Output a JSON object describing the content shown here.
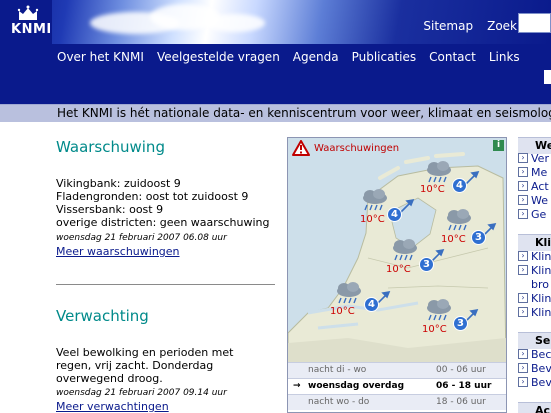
{
  "header": {
    "logo_text": "KNMI",
    "utility_nav": [
      "Sitemap",
      "Zoek"
    ],
    "main_nav": [
      "Over het KNMI",
      "Veelgestelde vragen",
      "Agenda",
      "Publicaties",
      "Contact",
      "Links"
    ],
    "tagline": "Het KNMI is hét nationale data- en kenniscentrum voor weer, klimaat en seismologie"
  },
  "warning": {
    "title": "Waarschuwing",
    "lines": [
      "Vikingbank: zuidoost 9",
      "Fladengronden: oost tot zuidoost 9",
      "Vissersbank: oost 9",
      "overige districten: geen waarschuwing"
    ],
    "timestamp": "woensdag 21 februari 2007 06.08 uur",
    "more_link": "Meer waarschuwingen"
  },
  "forecast": {
    "title": "Verwachting",
    "lines": [
      "Veel bewolking en perioden met",
      "regen, vrij zacht. Donderdag",
      "overwegend droog."
    ],
    "timestamp": "woensdag 21 februari 2007 09.14 uur",
    "more_link": "Meer verwachtingen"
  },
  "map": {
    "header": "Waarschuwingen",
    "info_label": "i",
    "stations": [
      {
        "temp": "10°C",
        "wind": "4"
      },
      {
        "temp": "10°C",
        "wind": "4"
      },
      {
        "temp": "10°C",
        "wind": "3"
      },
      {
        "temp": "10°C",
        "wind": "3"
      },
      {
        "temp": "10°C",
        "wind": "4"
      },
      {
        "temp": "10°C",
        "wind": "3"
      }
    ],
    "periods": [
      {
        "label": "nacht di - wo",
        "range": "00 - 06 uur",
        "selected": false
      },
      {
        "label": "woensdag overdag",
        "range": "06 - 18 uur",
        "selected": true
      },
      {
        "label": "nacht wo - do",
        "range": "18 - 06 uur",
        "selected": false
      }
    ],
    "selected_marker": "→"
  },
  "sidebar": {
    "sections": [
      {
        "head": "We",
        "items": [
          "Ver",
          "Me",
          "Act",
          "We",
          "Ge"
        ]
      },
      {
        "head": "Kli",
        "items": [
          "Klin",
          "Klin",
          "bro",
          "Klin",
          "Klin"
        ]
      },
      {
        "head": "Se",
        "items": [
          "Bec",
          "Bev",
          "Bev"
        ]
      },
      {
        "head": "Ac",
        "items": []
      }
    ]
  },
  "colors": {
    "header_blue": "#0a1a8c",
    "accent_teal": "#008a8a",
    "warning_red": "#c00000",
    "wind_blue": "#2f6fd1"
  }
}
